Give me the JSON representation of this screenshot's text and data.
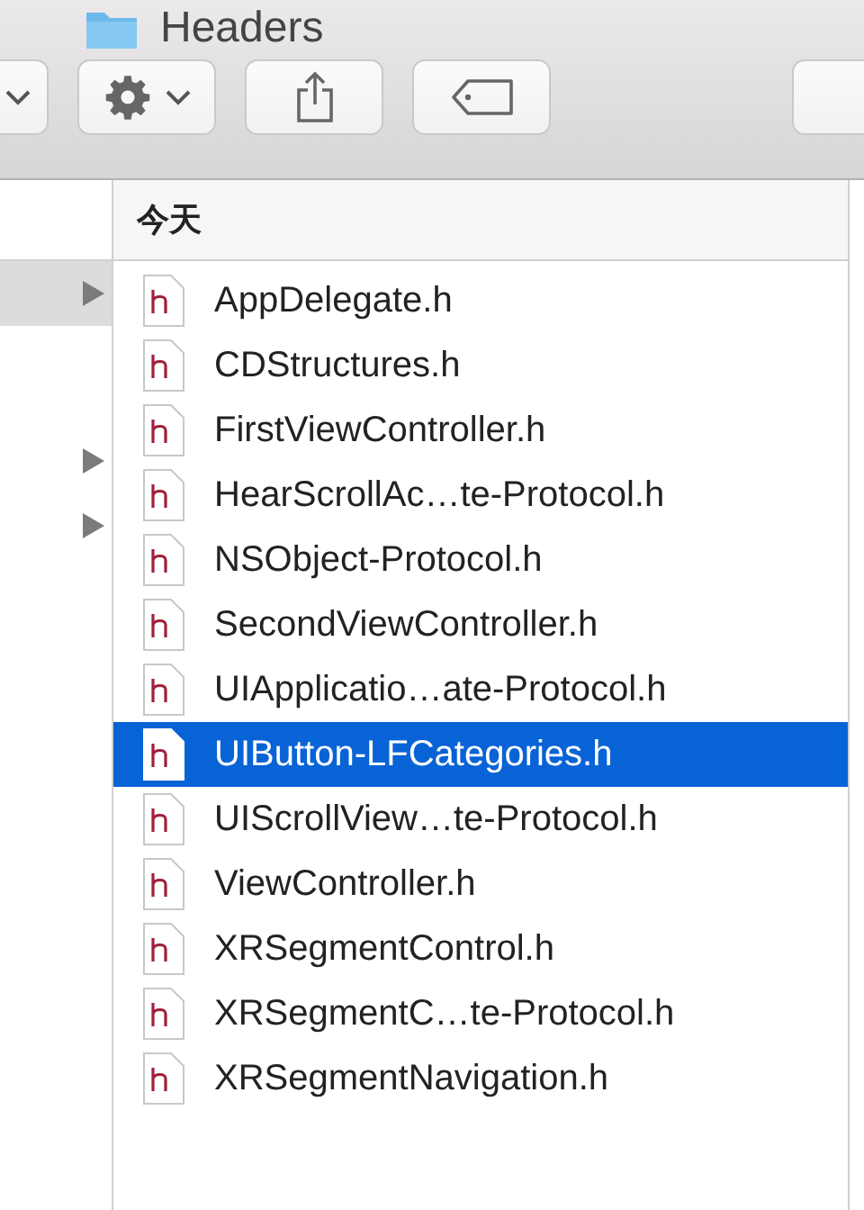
{
  "window": {
    "title": "Headers"
  },
  "toolbar": {
    "buttons": [
      {
        "kind": "chevron"
      },
      {
        "kind": "gear"
      },
      {
        "kind": "share"
      },
      {
        "kind": "tag"
      },
      {
        "kind": "blank"
      }
    ]
  },
  "left_column": {
    "items": [
      {
        "selected": true,
        "expandable": true
      },
      {
        "selected": false,
        "expandable": true
      },
      {
        "selected": false,
        "expandable": true
      }
    ]
  },
  "file_list": {
    "header": "今天",
    "files": [
      {
        "name": "AppDelegate.h",
        "selected": false
      },
      {
        "name": "CDStructures.h",
        "selected": false
      },
      {
        "name": "FirstViewController.h",
        "selected": false
      },
      {
        "name": "HearScrollAc…te-Protocol.h",
        "selected": false
      },
      {
        "name": "NSObject-Protocol.h",
        "selected": false
      },
      {
        "name": "SecondViewController.h",
        "selected": false
      },
      {
        "name": "UIApplicatio…ate-Protocol.h",
        "selected": false
      },
      {
        "name": "UIButton-LFCategories.h",
        "selected": true
      },
      {
        "name": "UIScrollView…te-Protocol.h",
        "selected": false
      },
      {
        "name": "ViewController.h",
        "selected": false
      },
      {
        "name": "XRSegmentControl.h",
        "selected": false
      },
      {
        "name": "XRSegmentC…te-Protocol.h",
        "selected": false
      },
      {
        "name": "XRSegmentNavigation.h",
        "selected": false
      }
    ]
  }
}
